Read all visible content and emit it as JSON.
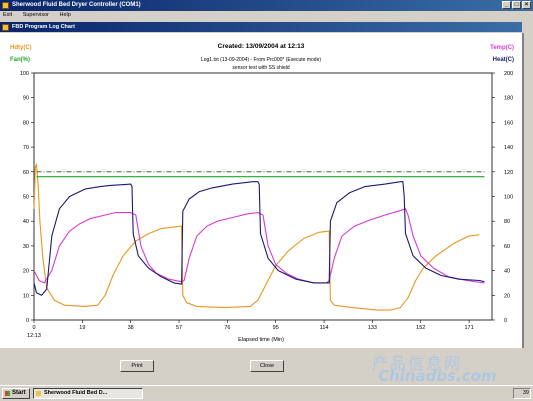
{
  "app": {
    "title": "Sherwood Fluid Bed Dryer Controller (COM1)",
    "menu": [
      "Exit",
      "Supervisor",
      "Help"
    ],
    "window_buttons": [
      "_",
      "□",
      "×"
    ]
  },
  "child_window": {
    "title": "FBD Program Log Chart"
  },
  "chart_header": {
    "created": "Created: 13/09/2004 at 12:13",
    "log_line": "Log1.txt (13-09-2004) - From Prc000* (Execute mode)",
    "note": "sensor test with SS shield",
    "left_top_label": "Hdty(C)",
    "left_bottom_label": "Fan(%)",
    "right_top_label": "Temp(C)",
    "right_bottom_label": "Heat(C)"
  },
  "colors": {
    "humidity": "#e8961e",
    "fan": "#1fa62a",
    "temp": "#d63bd6",
    "heat": "#1a1a6e",
    "setpoint": "#1c5a1c"
  },
  "chart_data": {
    "type": "line",
    "xlabel": "Elapsed time (Min)",
    "x_ticks": [
      "0",
      "19",
      "38",
      "57",
      "76",
      "95",
      "114",
      "133",
      "152",
      "171"
    ],
    "x_start_label": "12:13",
    "xlim": [
      0,
      180
    ],
    "y_left_ticks": [
      "0",
      "10",
      "20",
      "30",
      "40",
      "50",
      "60",
      "70",
      "80",
      "90",
      "100"
    ],
    "y_right_ticks": [
      "0",
      "20",
      "40",
      "60",
      "80",
      "100",
      "120",
      "140",
      "160",
      "180",
      "200"
    ],
    "ylim_left": [
      0,
      100
    ],
    "ylim_right": [
      0,
      200
    ],
    "series": [
      {
        "name": "Hdty(C)",
        "axis": "left",
        "color": "#e8961e",
        "points": [
          [
            0,
            45
          ],
          [
            0.5,
            62
          ],
          [
            1,
            63
          ],
          [
            1.6,
            55
          ],
          [
            2.3,
            40
          ],
          [
            3.5,
            25
          ],
          [
            5,
            13
          ],
          [
            8,
            8
          ],
          [
            12,
            6
          ],
          [
            20,
            5.5
          ],
          [
            25,
            6
          ],
          [
            28,
            10
          ],
          [
            31,
            18
          ],
          [
            35,
            26
          ],
          [
            40,
            32
          ],
          [
            45,
            35
          ],
          [
            50,
            37
          ],
          [
            58,
            38
          ],
          [
            58.5,
            10
          ],
          [
            60,
            7
          ],
          [
            64,
            5.5
          ],
          [
            75,
            5
          ],
          [
            85,
            5.5
          ],
          [
            88,
            8
          ],
          [
            91,
            14
          ],
          [
            95,
            22
          ],
          [
            100,
            28
          ],
          [
            106,
            33
          ],
          [
            112,
            35.5
          ],
          [
            116,
            36
          ],
          [
            116.5,
            8
          ],
          [
            118,
            6
          ],
          [
            125,
            5
          ],
          [
            135,
            4
          ],
          [
            140,
            4
          ],
          [
            144,
            5
          ],
          [
            147,
            9
          ],
          [
            150,
            16
          ],
          [
            153,
            21
          ],
          [
            158,
            26
          ],
          [
            165,
            31
          ],
          [
            171,
            34
          ],
          [
            175,
            34.5
          ]
        ]
      },
      {
        "name": "Temp(C)",
        "axis": "right",
        "color": "#d63bd6",
        "points": [
          [
            0,
            40
          ],
          [
            2,
            32
          ],
          [
            4,
            30
          ],
          [
            7,
            40
          ],
          [
            10,
            60
          ],
          [
            14,
            72
          ],
          [
            18,
            78
          ],
          [
            22,
            82
          ],
          [
            28,
            85
          ],
          [
            32,
            87
          ],
          [
            38,
            87
          ],
          [
            40,
            85
          ],
          [
            42,
            60
          ],
          [
            45,
            45
          ],
          [
            48,
            38
          ],
          [
            53,
            33
          ],
          [
            58,
            31
          ],
          [
            59,
            32
          ],
          [
            61,
            50
          ],
          [
            64,
            68
          ],
          [
            68,
            76
          ],
          [
            72,
            80
          ],
          [
            78,
            83
          ],
          [
            84,
            86
          ],
          [
            88,
            87
          ],
          [
            90,
            85
          ],
          [
            92,
            60
          ],
          [
            95,
            45
          ],
          [
            99,
            38
          ],
          [
            104,
            33
          ],
          [
            110,
            30
          ],
          [
            115,
            30
          ],
          [
            116,
            32
          ],
          [
            118,
            50
          ],
          [
            121,
            68
          ],
          [
            126,
            76
          ],
          [
            132,
            81
          ],
          [
            138,
            85
          ],
          [
            143,
            88
          ],
          [
            146,
            90
          ],
          [
            147,
            85
          ],
          [
            149,
            68
          ],
          [
            152,
            52
          ],
          [
            157,
            42
          ],
          [
            163,
            35
          ],
          [
            170,
            32
          ],
          [
            177,
            30
          ]
        ]
      },
      {
        "name": "Heat(C)",
        "axis": "right",
        "color": "#1a1a6e",
        "points": [
          [
            0,
            30
          ],
          [
            1,
            22
          ],
          [
            3,
            20
          ],
          [
            5,
            25
          ],
          [
            7,
            68
          ],
          [
            10,
            90
          ],
          [
            14,
            100
          ],
          [
            20,
            106
          ],
          [
            26,
            108
          ],
          [
            30,
            109
          ],
          [
            38,
            110
          ],
          [
            38.5,
            108
          ],
          [
            39,
            70
          ],
          [
            41,
            52
          ],
          [
            45,
            42
          ],
          [
            50,
            35
          ],
          [
            55,
            30
          ],
          [
            58,
            29
          ],
          [
            58.5,
            88
          ],
          [
            61,
            98
          ],
          [
            65,
            104
          ],
          [
            70,
            107
          ],
          [
            78,
            110
          ],
          [
            86,
            112
          ],
          [
            88,
            112
          ],
          [
            88.5,
            110
          ],
          [
            89,
            70
          ],
          [
            92,
            50
          ],
          [
            96,
            40
          ],
          [
            103,
            33
          ],
          [
            110,
            30
          ],
          [
            116,
            30
          ],
          [
            116.5,
            80
          ],
          [
            119,
            95
          ],
          [
            124,
            103
          ],
          [
            130,
            108
          ],
          [
            138,
            110
          ],
          [
            144,
            112
          ],
          [
            145,
            112
          ],
          [
            145.5,
            100
          ],
          [
            146,
            70
          ],
          [
            149,
            52
          ],
          [
            154,
            42
          ],
          [
            160,
            36
          ],
          [
            167,
            33
          ],
          [
            175,
            32
          ],
          [
            177,
            31
          ]
        ]
      },
      {
        "name": "Fan(%)",
        "axis": "left",
        "color": "#1fa62a",
        "points": [
          [
            1,
            58
          ],
          [
            177,
            58
          ]
        ]
      },
      {
        "name": "setpoint",
        "axis": "right",
        "color": "#1c5a1c",
        "dashed": true,
        "points": [
          [
            1,
            120
          ],
          [
            177,
            120
          ]
        ]
      }
    ]
  },
  "buttons": {
    "print": "Print",
    "close": "Close"
  },
  "taskbar": {
    "start": "Start",
    "task": "Sherwood Fluid Bed D...",
    "clock": "39"
  },
  "watermark": {
    "line1": "产品信息网",
    "line2": "Chinadbs.com"
  }
}
